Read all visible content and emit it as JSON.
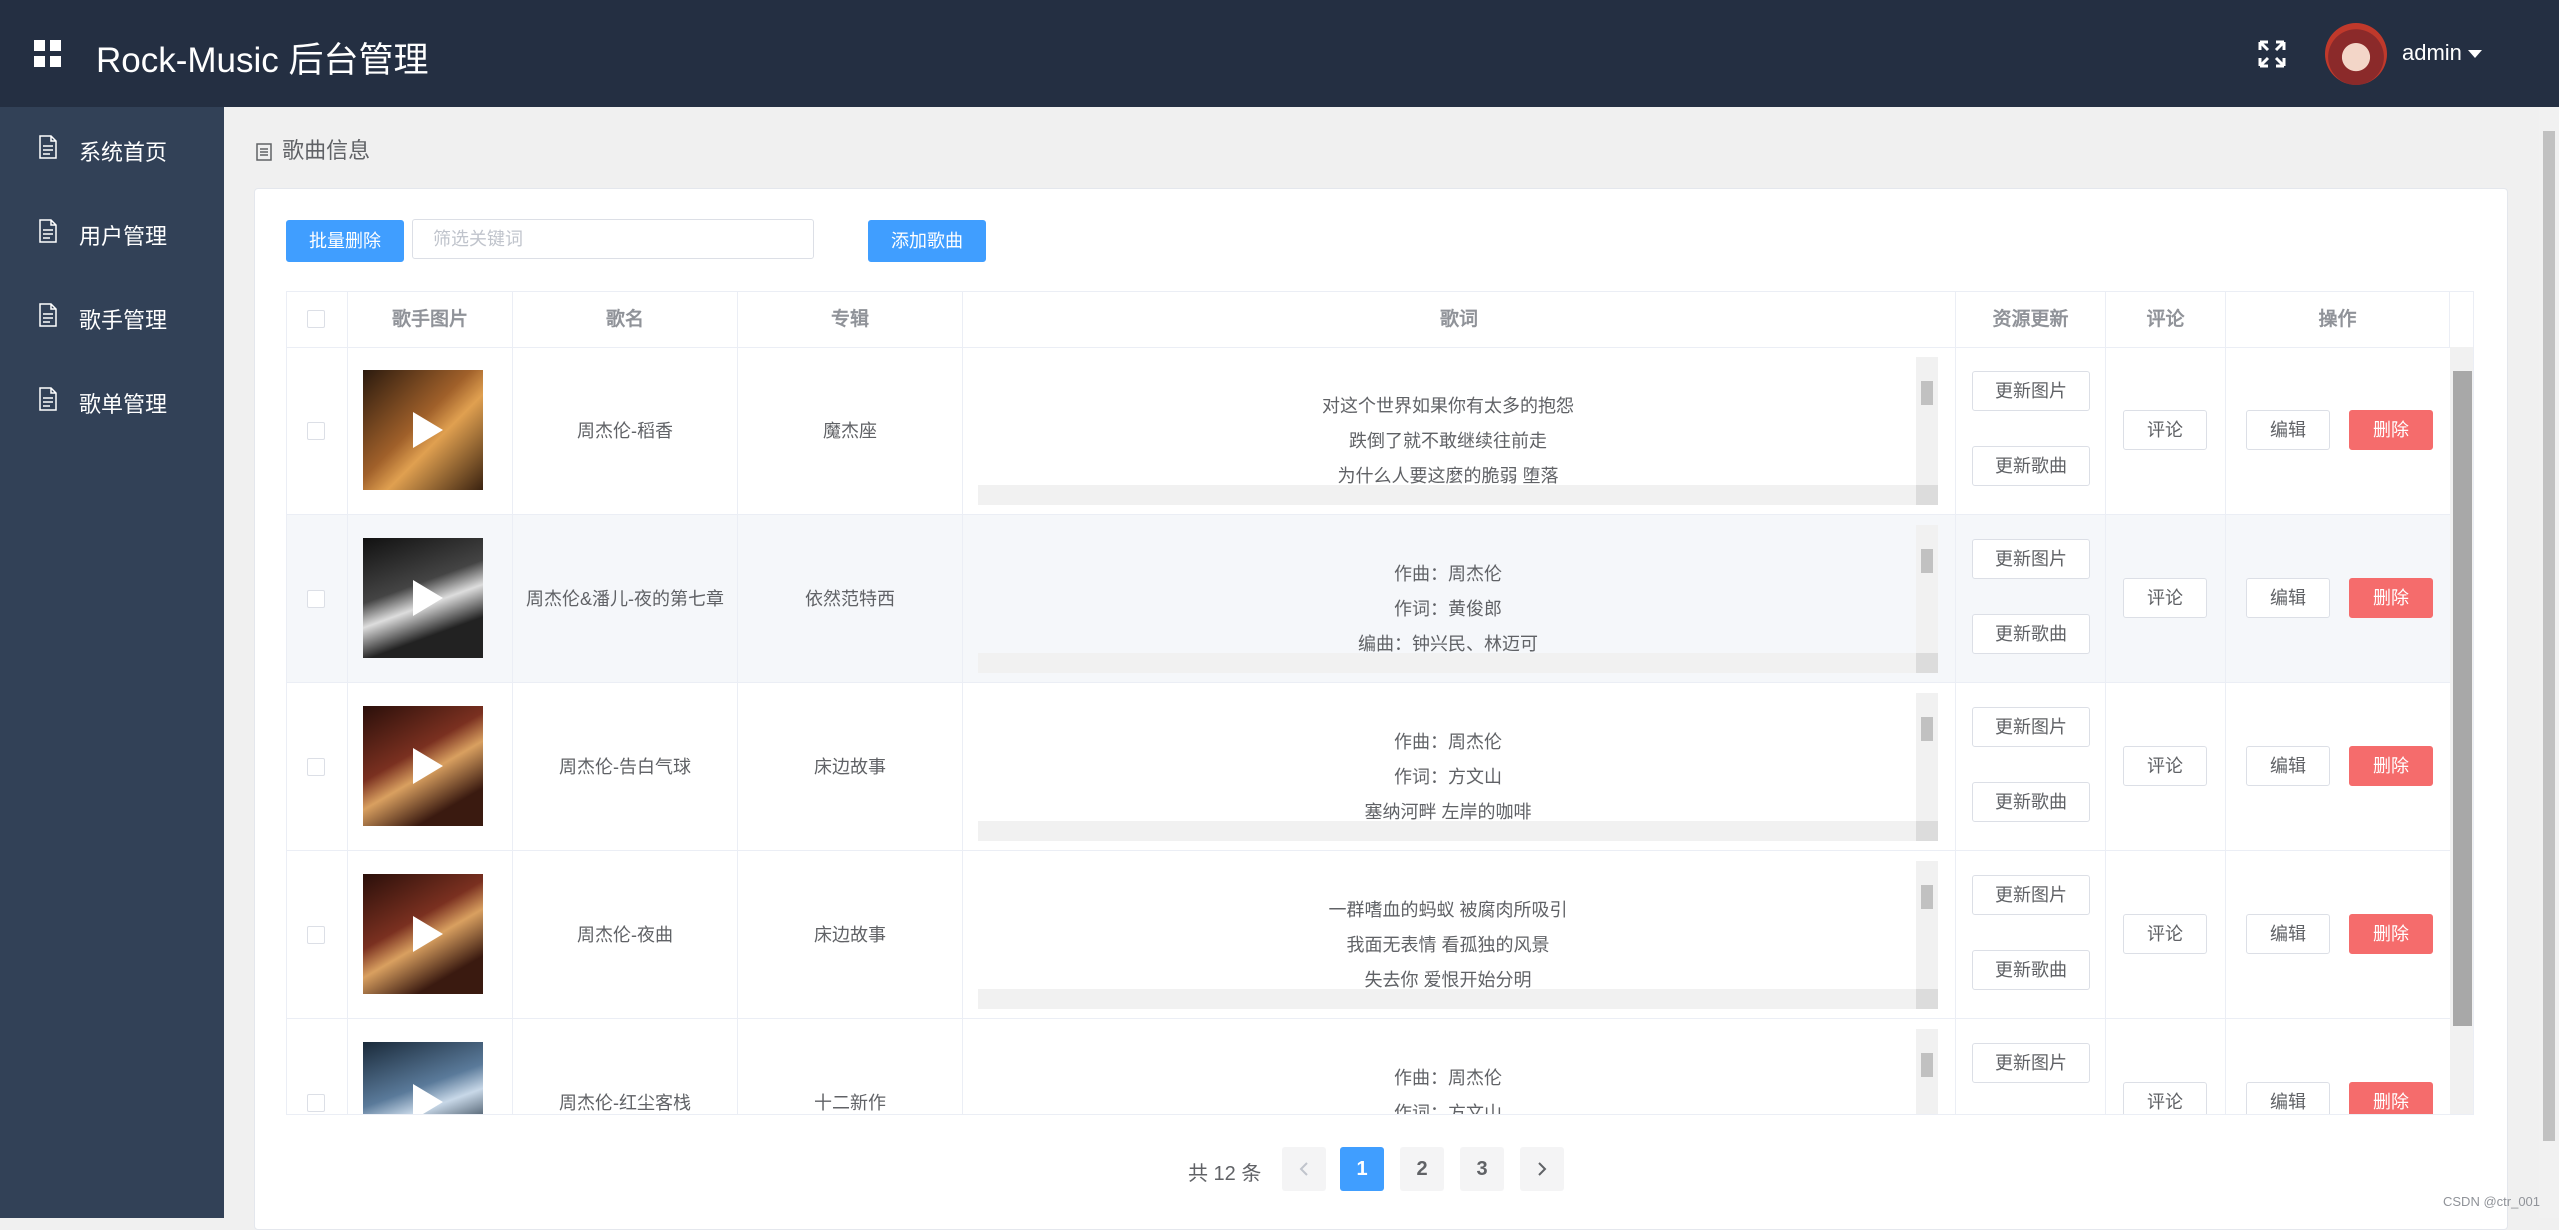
{
  "header": {
    "title": "Rock-Music 后台管理",
    "username": "admin"
  },
  "sidebar": {
    "items": [
      {
        "label": "系统首页"
      },
      {
        "label": "用户管理"
      },
      {
        "label": "歌手管理"
      },
      {
        "label": "歌单管理"
      }
    ]
  },
  "breadcrumb": {
    "label": "歌曲信息"
  },
  "toolbar": {
    "batch_delete": "批量删除",
    "search_placeholder": "筛选关键词",
    "add_song": "添加歌曲"
  },
  "table": {
    "columns": [
      "歌手图片",
      "歌名",
      "专辑",
      "歌词",
      "资源更新",
      "评论",
      "操作"
    ],
    "action_labels": {
      "update_image": "更新图片",
      "update_song": "更新歌曲",
      "comment": "评论",
      "edit": "编辑",
      "delete": "删除"
    },
    "rows": [
      {
        "name": "周杰伦-稻香",
        "album": "魔杰座",
        "lyrics": [
          "对这个世界如果你有太多的抱怨",
          "跌倒了就不敢继续往前走",
          "为什么人要这麼的脆弱 堕落"
        ]
      },
      {
        "name": "周杰伦&潘儿-夜的第七章",
        "album": "依然范特西",
        "lyrics": [
          "作曲：周杰伦",
          "作词：黄俊郎",
          "编曲：钟兴民、林迈可"
        ]
      },
      {
        "name": "周杰伦-告白气球",
        "album": "床边故事",
        "lyrics": [
          "作曲：周杰伦",
          "作词：方文山",
          "塞纳河畔 左岸的咖啡"
        ]
      },
      {
        "name": "周杰伦-夜曲",
        "album": "床边故事",
        "lyrics": [
          "一群嗜血的蚂蚁 被腐肉所吸引",
          "我面无表情 看孤独的风景",
          "失去你 爱恨开始分明"
        ]
      },
      {
        "name": "周杰伦-红尘客栈",
        "album": "十二新作",
        "lyrics": [
          "作曲：周杰伦",
          "作词：方文山",
          ""
        ]
      }
    ]
  },
  "pagination": {
    "total": "共 12 条",
    "pages": [
      "1",
      "2",
      "3"
    ],
    "current": "1"
  },
  "watermark": "CSDN @ctr_001",
  "colors": {
    "header_bg": "#242f42",
    "sidebar_bg": "#324157",
    "primary": "#409eff",
    "danger": "#f56c6c"
  }
}
